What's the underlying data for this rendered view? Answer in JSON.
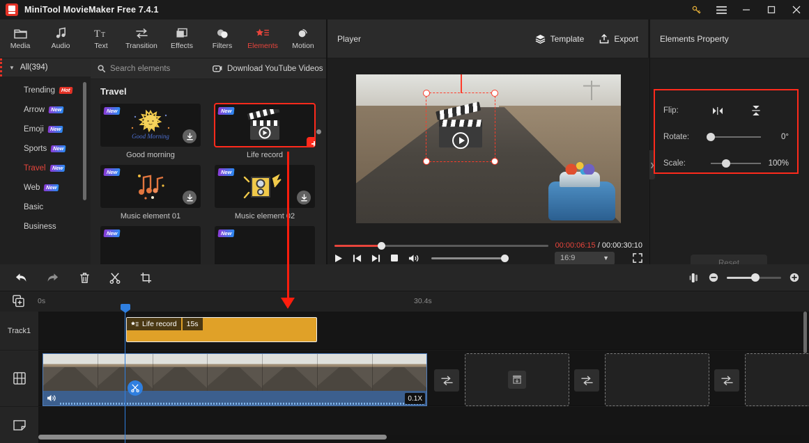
{
  "window": {
    "app_title": "MiniTool MovieMaker Free 7.4.1",
    "controls": {
      "key": "key-icon",
      "menu": "hamburger-icon",
      "minimize": "–",
      "maximize": "□",
      "close": "✕"
    }
  },
  "tabs": [
    {
      "label": "Media",
      "icon": "folder-icon",
      "active": false
    },
    {
      "label": "Audio",
      "icon": "music-note-icon",
      "active": false
    },
    {
      "label": "Text",
      "icon": "text-icon",
      "active": false
    },
    {
      "label": "Transition",
      "icon": "transition-icon",
      "active": false
    },
    {
      "label": "Effects",
      "icon": "effects-icon",
      "active": false
    },
    {
      "label": "Filters",
      "icon": "filters-icon",
      "active": false
    },
    {
      "label": "Elements",
      "icon": "elements-icon",
      "active": true
    },
    {
      "label": "Motion",
      "icon": "motion-icon",
      "active": false
    }
  ],
  "categories": {
    "all_label": "All(394)",
    "items": [
      {
        "label": "Trending",
        "badge": "Hot",
        "badge_type": "hot",
        "selected": false
      },
      {
        "label": "Arrow",
        "badge": "New",
        "badge_type": "new",
        "selected": false
      },
      {
        "label": "Emoji",
        "badge": "New",
        "badge_type": "new",
        "selected": false
      },
      {
        "label": "Sports",
        "badge": "New",
        "badge_type": "new",
        "selected": false
      },
      {
        "label": "Travel",
        "badge": "New",
        "badge_type": "new",
        "selected": true
      },
      {
        "label": "Web",
        "badge": "New",
        "badge_type": "new",
        "selected": false
      },
      {
        "label": "Basic",
        "badge": "",
        "badge_type": "",
        "selected": false
      },
      {
        "label": "Business",
        "badge": "",
        "badge_type": "",
        "selected": false
      }
    ]
  },
  "browser": {
    "search_placeholder": "Search elements",
    "youtube_label": "Download YouTube Videos",
    "group_title": "Travel",
    "elements": [
      {
        "name": "Good morning",
        "badge": "New",
        "state": "download",
        "selected": false
      },
      {
        "name": "Life record",
        "badge": "New",
        "state": "add",
        "selected": true
      },
      {
        "name": "Music element 01",
        "badge": "New",
        "state": "download",
        "selected": false
      },
      {
        "name": "Music element 02",
        "badge": "New",
        "state": "download",
        "selected": false
      }
    ]
  },
  "player": {
    "title": "Player",
    "template_label": "Template",
    "export_label": "Export",
    "current_time": "00:00:06:15",
    "time_separator": "/",
    "total_time": "00:00:30:10",
    "aspect_ratio": "16:9",
    "progress_percent": 22,
    "volume_percent": 100,
    "buttons": {
      "play": "play-icon",
      "prev_frame": "previous-frame-icon",
      "next_frame": "next-frame-icon",
      "stop": "stop-icon",
      "volume": "volume-icon",
      "fullscreen": "fullscreen-icon"
    }
  },
  "properties": {
    "header": "Elements Property",
    "flip_label": "Flip:",
    "flip_horizontal_icon": "flip-horizontal-icon",
    "flip_vertical_icon": "flip-vertical-icon",
    "rotate_label": "Rotate:",
    "rotate_value": "0°",
    "rotate_percent": 0,
    "scale_label": "Scale:",
    "scale_value": "100%",
    "scale_percent": 30,
    "reset_label": "Reset",
    "highlight_color": "#ff2a1c"
  },
  "timeline": {
    "tools": [
      {
        "name": "undo-icon"
      },
      {
        "name": "redo-icon"
      },
      {
        "name": "delete-icon"
      },
      {
        "name": "split-icon"
      },
      {
        "name": "crop-icon"
      }
    ],
    "right_tools": [
      {
        "name": "split-view-icon"
      },
      {
        "name": "zoom-out-icon"
      },
      {
        "name": "zoom-in-icon"
      }
    ],
    "zoom_percent": 52,
    "ruler": {
      "start": "0s",
      "end": "30.4s"
    },
    "tracks": [
      {
        "label": "Track1",
        "icon": ""
      },
      {
        "label": "",
        "icon": "film-strip-icon"
      },
      {
        "label": "",
        "icon": "sticker-icon"
      }
    ],
    "element_clip": {
      "title": "Life record",
      "duration": "15s",
      "icon": "elements-icon",
      "color": "#e0a128"
    },
    "video_clip": {
      "speed": "0.1X",
      "volume_icon": "volume-icon",
      "split_icon": "scissors-icon"
    },
    "transition_buttons": 3,
    "drop_zones": 3
  }
}
